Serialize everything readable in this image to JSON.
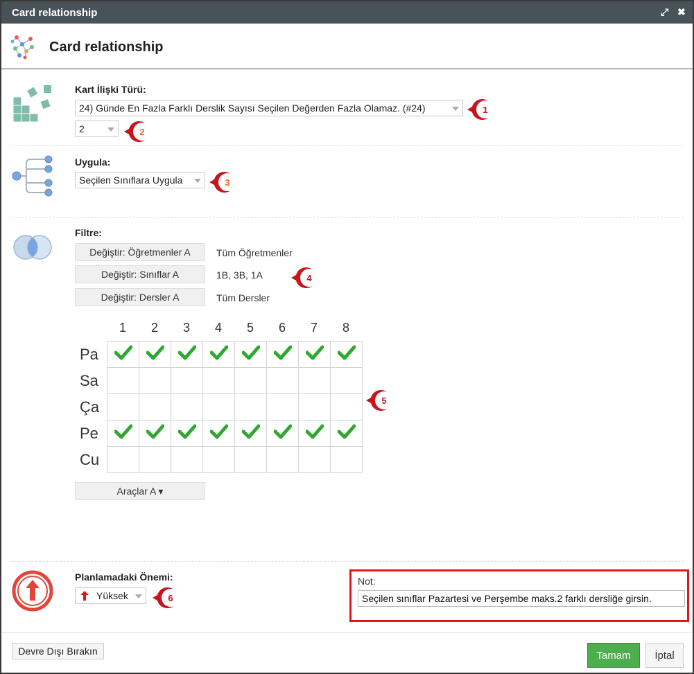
{
  "window": {
    "title": "Card relationship"
  },
  "header": {
    "title": "Card relationship"
  },
  "relation": {
    "label": "Kart İlişki Türü:",
    "type_value": "24) Günde En Fazla Farklı Derslik Sayısı Seçilen Değerden Fazla Olamaz. (#24)",
    "count_value": "2"
  },
  "apply": {
    "label": "Uygula:",
    "value": "Seçilen Sınıflara Uygula"
  },
  "filter": {
    "label": "Filtre:",
    "rows": [
      {
        "button": "Değiştir: Öğretmenler A",
        "value": "Tüm Öğretmenler"
      },
      {
        "button": "Değiştir: Sınıflar A",
        "value": "1B, 3B, 1A"
      },
      {
        "button": "Değiştir: Dersler A",
        "value": "Tüm Dersler"
      }
    ]
  },
  "grid": {
    "columns": [
      "1",
      "2",
      "3",
      "4",
      "5",
      "6",
      "7",
      "8"
    ],
    "rows": [
      {
        "day": "Pa",
        "checked": [
          true,
          true,
          true,
          true,
          true,
          true,
          true,
          true
        ]
      },
      {
        "day": "Sa",
        "checked": [
          false,
          false,
          false,
          false,
          false,
          false,
          false,
          false
        ]
      },
      {
        "day": "Ça",
        "checked": [
          false,
          false,
          false,
          false,
          false,
          false,
          false,
          false
        ]
      },
      {
        "day": "Pe",
        "checked": [
          true,
          true,
          true,
          true,
          true,
          true,
          true,
          true
        ]
      },
      {
        "day": "Cu",
        "checked": [
          false,
          false,
          false,
          false,
          false,
          false,
          false,
          false
        ]
      }
    ],
    "tools_label": "Araçlar A ▾"
  },
  "importance": {
    "label": "Planlamadaki Önemi:",
    "value": "Yüksek"
  },
  "note": {
    "label": "Not:",
    "value": "Seçilen sınıflar Pazartesi ve Perşembe maks.2 farklı dersliğe girsin."
  },
  "footer": {
    "disable_label": "Devre Dışı Bırakın",
    "ok_label": "Tamam",
    "cancel_label": "İptal"
  },
  "badges": [
    "1",
    "2",
    "3",
    "4",
    "5",
    "6"
  ],
  "colors": {
    "titlebar": "#475259",
    "accent_red": "#e3141b",
    "check_green": "#2fa82f",
    "ok_green": "#4cae4c"
  }
}
